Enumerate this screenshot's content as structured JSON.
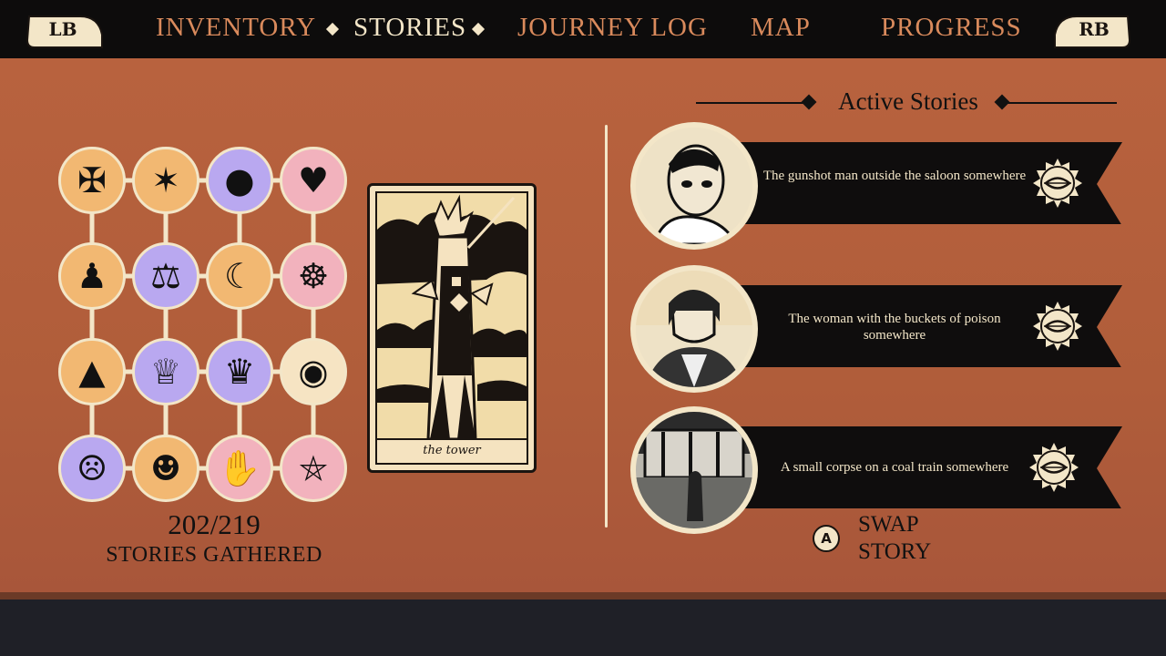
{
  "nav": {
    "left_bumper": "LB",
    "right_bumper": "RB",
    "tabs": [
      {
        "label": "INVENTORY",
        "active": false
      },
      {
        "label": "STORIES",
        "active": true
      },
      {
        "label": "JOURNEY LOG",
        "active": false
      },
      {
        "label": "MAP",
        "active": false
      },
      {
        "label": "PROGRESS",
        "active": false
      }
    ]
  },
  "collection": {
    "tokens": [
      {
        "icon": "pentacle-cross-icon",
        "glyph": "✠",
        "color": "#f2b872"
      },
      {
        "icon": "star-icon",
        "glyph": "✶",
        "color": "#f2b872"
      },
      {
        "icon": "world-icon",
        "glyph": "●",
        "color": "#b9a8f0"
      },
      {
        "icon": "heart-icon",
        "glyph": "♥",
        "color": "#f2b2bd"
      },
      {
        "icon": "sack-icon",
        "glyph": "♟",
        "color": "#f2b872"
      },
      {
        "icon": "scales-icon",
        "glyph": "⚖",
        "color": "#b9a8f0"
      },
      {
        "icon": "moon-icon",
        "glyph": "☾",
        "color": "#f2b872"
      },
      {
        "icon": "wheel-icon",
        "glyph": "☸",
        "color": "#f2b2bd"
      },
      {
        "icon": "witch-hat-icon",
        "glyph": "▲",
        "color": "#f2b872"
      },
      {
        "icon": "chalice-icon",
        "glyph": "♕",
        "color": "#b9a8f0"
      },
      {
        "icon": "queen-face-icon",
        "glyph": "♛",
        "color": "#b9a8f0"
      },
      {
        "icon": "eye-icon",
        "glyph": "◉",
        "color": "#f6e4c3"
      },
      {
        "icon": "screaming-face-icon",
        "glyph": "☹",
        "color": "#b9a8f0"
      },
      {
        "icon": "grinning-sun-icon",
        "glyph": "☻",
        "color": "#f2b872"
      },
      {
        "icon": "hand-icon",
        "glyph": "✋",
        "color": "#f2b2bd"
      },
      {
        "icon": "pentagram-icon",
        "glyph": "⛤",
        "color": "#f2b2bd"
      }
    ],
    "selected_card": {
      "label": "the tower",
      "icon": "tower-card-icon"
    },
    "count": "202/219",
    "count_label": "STORIES GATHERED"
  },
  "active_stories": {
    "title": "Active Stories",
    "items": [
      {
        "text": "The gunshot man outside the saloon somewhere",
        "portrait": "man-portrait-icon"
      },
      {
        "text": "The woman with the buckets of poison somewhere",
        "portrait": "woman-portrait-icon"
      },
      {
        "text": "A small corpse on a coal train somewhere",
        "portrait": "train-scene-icon"
      }
    ]
  },
  "swap": {
    "button": "A",
    "line1": "SWAP",
    "line2": "STORY"
  },
  "colors": {
    "accent": "#d98a5c",
    "cream": "#f3e6c8",
    "panel": "#b25e3a",
    "bar": "#0d0c0c"
  }
}
